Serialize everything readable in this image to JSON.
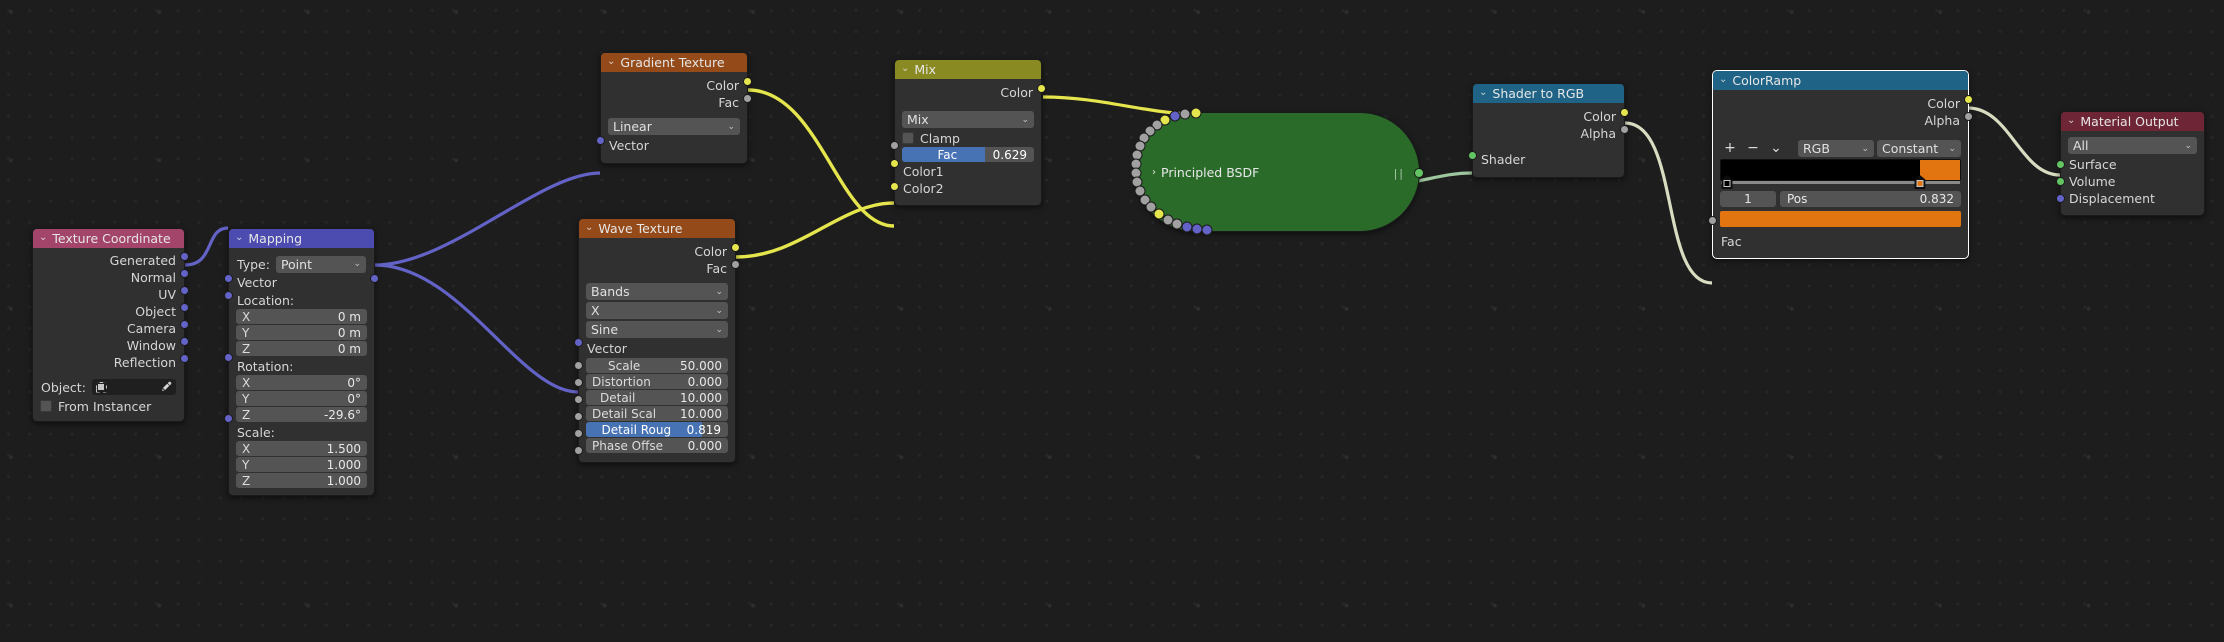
{
  "app": {
    "editor": "Blender Shader Node Editor"
  },
  "nodes": {
    "texture_coordinate": {
      "title": "Texture Coordinate",
      "header_color": "#a3456a",
      "outputs": [
        "Generated",
        "Normal",
        "UV",
        "Object",
        "Camera",
        "Window",
        "Reflection"
      ],
      "object_label": "Object:",
      "object_value": "",
      "from_instancer_label": "From Instancer",
      "from_instancer_checked": false
    },
    "mapping": {
      "title": "Mapping",
      "header_color": "#4b4bb0",
      "type_label": "Type:",
      "type_value": "Point",
      "vector_input": "Vector",
      "location_label": "Location:",
      "location": [
        {
          "axis": "X",
          "value": "0 m"
        },
        {
          "axis": "Y",
          "value": "0 m"
        },
        {
          "axis": "Z",
          "value": "0 m"
        }
      ],
      "rotation_label": "Rotation:",
      "rotation": [
        {
          "axis": "X",
          "value": "0°"
        },
        {
          "axis": "Y",
          "value": "0°"
        },
        {
          "axis": "Z",
          "value": "-29.6°"
        }
      ],
      "scale_label": "Scale:",
      "scale": [
        {
          "axis": "X",
          "value": "1.500"
        },
        {
          "axis": "Y",
          "value": "1.000"
        },
        {
          "axis": "Z",
          "value": "1.000"
        }
      ],
      "output": "Vector"
    },
    "gradient_texture": {
      "title": "Gradient Texture",
      "header_color": "#944a19",
      "outputs": [
        "Color",
        "Fac"
      ],
      "gradient_type": "Linear",
      "input": "Vector"
    },
    "wave_texture": {
      "title": "Wave Texture",
      "header_color": "#944a19",
      "outputs": [
        "Color",
        "Fac"
      ],
      "wave_type": "Bands",
      "bands_direction": "X",
      "wave_profile": "Sine",
      "vector_input": "Vector",
      "params": [
        {
          "name": "Scale",
          "value": "50.000",
          "slider": false
        },
        {
          "name": "Distortion",
          "value": "0.000",
          "slider": false
        },
        {
          "name": "Detail",
          "value": "10.000",
          "slider": false
        },
        {
          "name": "Detail Scal",
          "value": "10.000",
          "slider": false
        },
        {
          "name": "Detail Roug",
          "value": "0.819",
          "slider": true,
          "fill": 0.819
        },
        {
          "name": "Phase Offse",
          "value": "0.000",
          "slider": false
        }
      ]
    },
    "mix": {
      "title": "Mix",
      "header_color": "#8a8a22",
      "output": "Color",
      "blend_mode": "Mix",
      "clamp_label": "Clamp",
      "clamp_checked": false,
      "fac_label": "Fac",
      "fac_value": "0.629",
      "fac_fill": 0.629,
      "inputs": [
        "Color1",
        "Color2"
      ]
    },
    "principled_bsdf": {
      "title": "Principled BSDF",
      "body_color": "#2a6b2a",
      "collapsed": true
    },
    "shader_to_rgb": {
      "title": "Shader to RGB",
      "header_color": "#1f6386",
      "outputs": [
        "Color",
        "Alpha"
      ],
      "input": "Shader"
    },
    "color_ramp": {
      "title": "ColorRamp",
      "header_color": "#1f6386",
      "selected": true,
      "outputs": [
        "Color",
        "Alpha"
      ],
      "tools": {
        "add": "+",
        "remove": "−",
        "menu": "⌄"
      },
      "color_mode": "RGB",
      "interpolation": "Constant",
      "stops": [
        {
          "pos": 0.0,
          "color": "#000000"
        },
        {
          "pos": 0.832,
          "color": "#e2750f"
        }
      ],
      "active_index": "1",
      "pos_label": "Pos",
      "pos_value": "0.832",
      "active_color": "#e2750f",
      "input": "Fac"
    },
    "material_output": {
      "title": "Material Output",
      "header_color": "#6e2636",
      "target": "All",
      "inputs": [
        "Surface",
        "Volume",
        "Displacement"
      ]
    }
  },
  "icons": {
    "collapse": "⌄",
    "expand": "›",
    "dropdown": "⌄",
    "eyedropper": "eyedropper-icon"
  },
  "wire_colors": {
    "vector": "#6363c7",
    "color": "#e5e54d",
    "shader": "#d8dcc0",
    "grey": "#bdbdbd"
  }
}
